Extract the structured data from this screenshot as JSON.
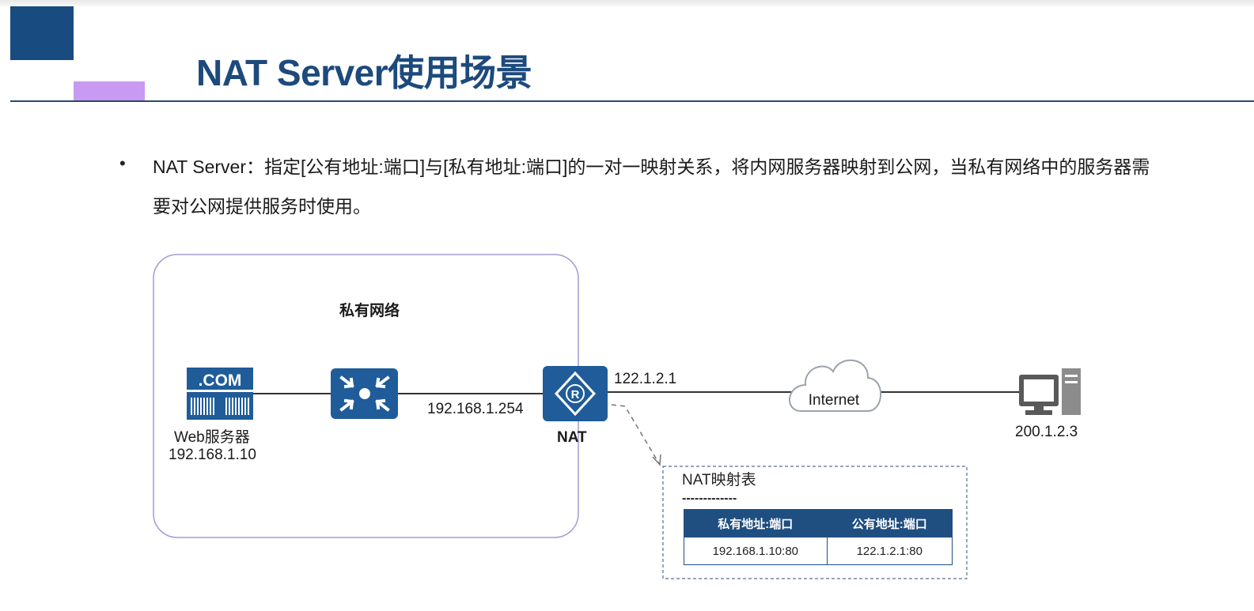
{
  "slide": {
    "title": "NAT Server使用场景",
    "bullet_symbol": "•",
    "bullet_text": "NAT Server：指定[公有地址:端口]与[私有地址:端口]的一对一映射关系，将内网服务器映射到公网，当私有网络中的服务器需要对公网提供服务时使用。"
  },
  "diagram": {
    "private_network_label": "私有网络",
    "web_server": {
      "icon_text": ".COM",
      "name": "Web服务器",
      "ip": "192.168.1.10"
    },
    "nat_router": {
      "inside_ip": "192.168.1.254",
      "outside_ip": "122.1.2.1",
      "label": "NAT",
      "icon_letter": "R"
    },
    "cloud_label": "Internet",
    "client_ip": "200.1.2.3",
    "nat_table": {
      "title": "NAT映射表",
      "divider": "-------------",
      "headers": [
        "私有地址:端口",
        "公有地址:端口"
      ],
      "rows": [
        [
          "192.168.1.10:80",
          "122.1.2.1:80"
        ]
      ]
    }
  },
  "colors": {
    "title": "#1d4a7d",
    "device_blue": "#1f5c99",
    "table_header": "#1f4e80",
    "accent_purple": "#c99af2",
    "accent_blue": "#184b80"
  }
}
